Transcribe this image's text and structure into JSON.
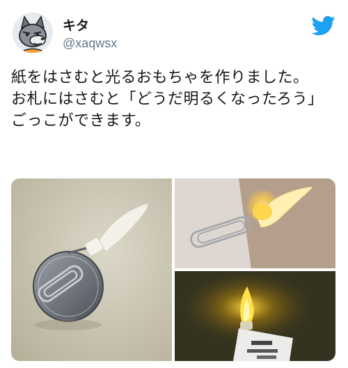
{
  "user": {
    "display_name": "キタ",
    "handle": "@xaqwsx",
    "avatar_icon": "wolf-cartoon-avatar"
  },
  "brand": {
    "icon": "twitter-bird-icon",
    "color": "#1da1f2"
  },
  "tweet": {
    "text": "紙をはさむと光るおもちゃを作りました。\nお札にはさむと「どうだ明るくなったろう」ごっこができます。"
  },
  "media": {
    "photos": [
      {
        "subject": "led-toy-clipped-to-coin-holder"
      },
      {
        "subject": "glowing-led-clipped-to-paper"
      },
      {
        "subject": "glowing-flame-led-on-banknote-in-dark"
      }
    ]
  }
}
